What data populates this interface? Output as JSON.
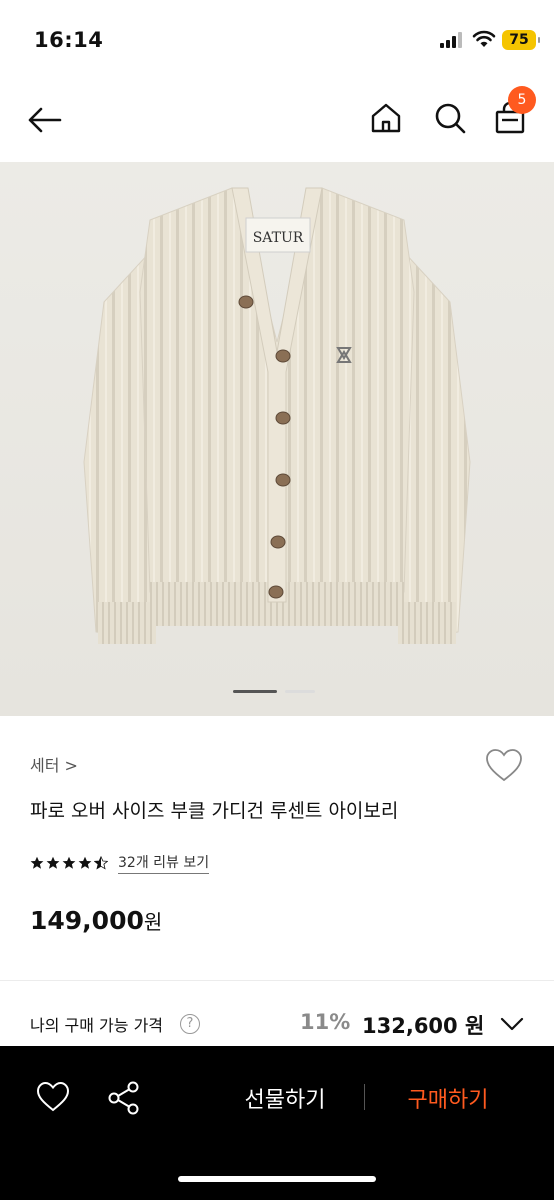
{
  "status_bar": {
    "time": "16:14",
    "battery": "75"
  },
  "header": {
    "cart_count": "5",
    "icons": [
      "arrow-left-icon",
      "home-icon",
      "search-icon",
      "shopping-bag-icon"
    ]
  },
  "product": {
    "image_brand_label": "SATUR",
    "category": "세터 >",
    "title": "파로 오버 사이즈 부클 가디건 루센트 아이보리",
    "rating": 4.5,
    "review_link": "32개 리뷰 보기",
    "price": "149,000",
    "price_unit": "원"
  },
  "my_price": {
    "label": "나의 구매 가능 가격",
    "help": "?",
    "discount": "11%",
    "price": "132,600 원"
  },
  "bottom_bar": {
    "gift_label": "선물하기",
    "buy_label": "구매하기"
  },
  "colors": {
    "accent": "#ff5a1f",
    "battery": "#f5c400",
    "bottom_bar_bg": "#000000"
  }
}
